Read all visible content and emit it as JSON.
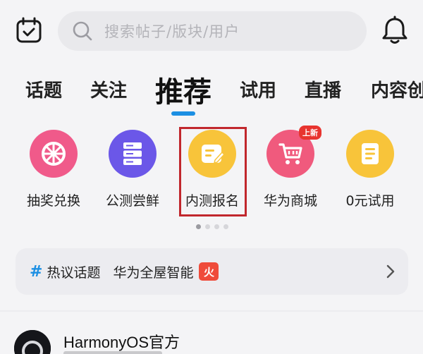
{
  "header": {
    "search_placeholder": "搜索帖子/版块/用户"
  },
  "tabs": [
    {
      "label": "话题",
      "active": false
    },
    {
      "label": "关注",
      "active": false
    },
    {
      "label": "推荐",
      "active": true
    },
    {
      "label": "试用",
      "active": false
    },
    {
      "label": "直播",
      "active": false
    },
    {
      "label": "内容创",
      "active": false
    }
  ],
  "shortcuts": [
    {
      "label": "抽奖兑换",
      "icon": "wheel-icon",
      "color": "#f05a8a"
    },
    {
      "label": "公测尝鲜",
      "icon": "server-icon",
      "color": "#6b57e8"
    },
    {
      "label": "内测报名",
      "icon": "edit-note-icon",
      "color": "#f8c43a",
      "highlighted": true
    },
    {
      "label": "华为商城",
      "icon": "cart-icon",
      "color": "#f05a7d",
      "badge": "上新"
    },
    {
      "label": "0元试用",
      "icon": "document-icon",
      "color": "#f8c43a"
    }
  ],
  "pager": {
    "pages": 4,
    "current_page": 1
  },
  "hot_topics": {
    "hash": "#",
    "title": "热议话题",
    "topic": "华为全屋智能",
    "badge": "火"
  },
  "post": {
    "author": "HarmonyOS官方"
  }
}
